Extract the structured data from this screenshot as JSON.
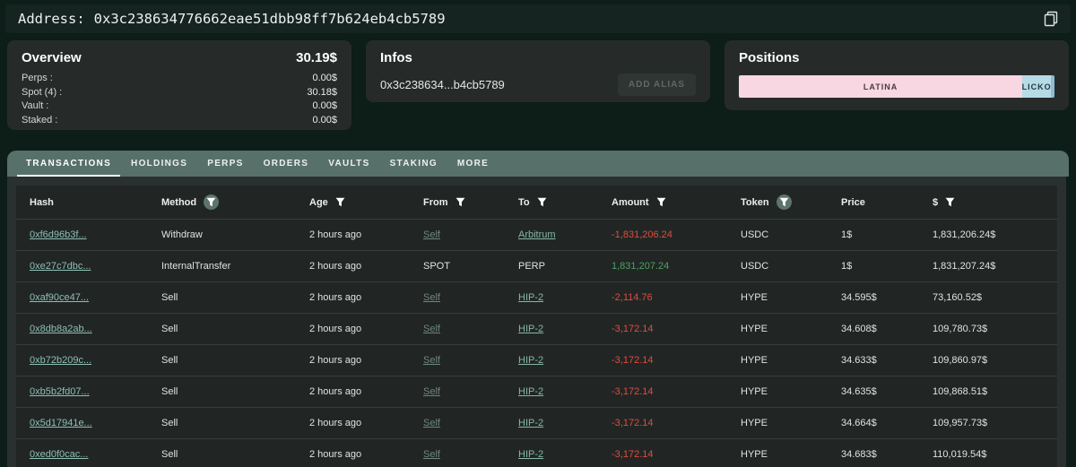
{
  "address_bar": {
    "label": "Address:",
    "value": "0x3c238634776662eae51dbb98ff7b624eb4cb5789",
    "copy_icon": "copy-icon"
  },
  "overview": {
    "title": "Overview",
    "total": "30.19$",
    "rows": [
      {
        "label": "Perps :",
        "value": "0.00$"
      },
      {
        "label": "Spot (4) :",
        "value": "30.18$"
      },
      {
        "label": "Vault :",
        "value": "0.00$"
      },
      {
        "label": "Staked :",
        "value": "0.00$"
      }
    ]
  },
  "infos": {
    "title": "Infos",
    "address_short": "0x3c238634...b4cb5789",
    "add_alias_label": "ADD ALIAS"
  },
  "positions": {
    "title": "Positions",
    "segments": [
      {
        "label": "LATINA",
        "width_pct": 89.8,
        "bg": "#f8d6e2",
        "fg": "#4a3b42"
      },
      {
        "label": "LICKO",
        "width_pct": 9.1,
        "bg": "#b7dae7",
        "fg": "#233941"
      },
      {
        "label": "",
        "width_pct": 1.1,
        "bg": "#8fbcd2",
        "fg": "#233941"
      }
    ]
  },
  "tabs": [
    {
      "label": "TRANSACTIONS",
      "active": true
    },
    {
      "label": "HOLDINGS",
      "active": false
    },
    {
      "label": "PERPS",
      "active": false
    },
    {
      "label": "ORDERS",
      "active": false
    },
    {
      "label": "VAULTS",
      "active": false
    },
    {
      "label": "STAKING",
      "active": false
    },
    {
      "label": "MORE",
      "active": false
    }
  ],
  "table": {
    "columns": [
      {
        "label": "Hash",
        "filter": "none"
      },
      {
        "label": "Method",
        "filter": "active"
      },
      {
        "label": "Age",
        "filter": "plain"
      },
      {
        "label": "From",
        "filter": "plain"
      },
      {
        "label": "To",
        "filter": "plain"
      },
      {
        "label": "Amount",
        "filter": "plain"
      },
      {
        "label": "Token",
        "filter": "active"
      },
      {
        "label": "Price",
        "filter": "none"
      },
      {
        "label": "$",
        "filter": "plain"
      }
    ],
    "rows": [
      {
        "hash": "0xf6d96b3f...",
        "method": "Withdraw",
        "age": "2 hours ago",
        "from": "Self",
        "from_link": true,
        "to": "Arbitrum",
        "to_link": true,
        "amount": "-1,831,206.24",
        "negative": true,
        "token": "USDC",
        "price": "1$",
        "usd": "1,831,206.24$"
      },
      {
        "hash": "0xe27c7dbc...",
        "method": "InternalTransfer",
        "age": "2 hours ago",
        "from": "SPOT",
        "from_link": false,
        "to": "PERP",
        "to_link": false,
        "amount": "1,831,207.24",
        "negative": false,
        "token": "USDC",
        "price": "1$",
        "usd": "1,831,207.24$"
      },
      {
        "hash": "0xaf90ce47...",
        "method": "Sell",
        "age": "2 hours ago",
        "from": "Self",
        "from_link": true,
        "to": "HIP-2",
        "to_link": true,
        "amount": "-2,114.76",
        "negative": true,
        "token": "HYPE",
        "price": "34.595$",
        "usd": "73,160.52$"
      },
      {
        "hash": "0x8db8a2ab...",
        "method": "Sell",
        "age": "2 hours ago",
        "from": "Self",
        "from_link": true,
        "to": "HIP-2",
        "to_link": true,
        "amount": "-3,172.14",
        "negative": true,
        "token": "HYPE",
        "price": "34.608$",
        "usd": "109,780.73$"
      },
      {
        "hash": "0xb72b209c...",
        "method": "Sell",
        "age": "2 hours ago",
        "from": "Self",
        "from_link": true,
        "to": "HIP-2",
        "to_link": true,
        "amount": "-3,172.14",
        "negative": true,
        "token": "HYPE",
        "price": "34.633$",
        "usd": "109,860.97$"
      },
      {
        "hash": "0xb5b2fd07...",
        "method": "Sell",
        "age": "2 hours ago",
        "from": "Self",
        "from_link": true,
        "to": "HIP-2",
        "to_link": true,
        "amount": "-3,172.14",
        "negative": true,
        "token": "HYPE",
        "price": "34.635$",
        "usd": "109,868.51$"
      },
      {
        "hash": "0x5d17941e...",
        "method": "Sell",
        "age": "2 hours ago",
        "from": "Self",
        "from_link": true,
        "to": "HIP-2",
        "to_link": true,
        "amount": "-3,172.14",
        "negative": true,
        "token": "HYPE",
        "price": "34.664$",
        "usd": "109,957.73$"
      },
      {
        "hash": "0xed0f0cac...",
        "method": "Sell",
        "age": "2 hours ago",
        "from": "Self",
        "from_link": true,
        "to": "HIP-2",
        "to_link": true,
        "amount": "-3,172.14",
        "negative": true,
        "token": "HYPE",
        "price": "34.683$",
        "usd": "110,019.54$"
      }
    ]
  },
  "colors": {
    "background": "#0d1d18",
    "topbar": "#152420",
    "card": "#262b2a",
    "tabbar": "#57706a",
    "panel": "#2a2f2f",
    "table": "#212625",
    "negative": "#e04b3d",
    "positive": "#4fa05f",
    "hash_link": "#8fbfb4",
    "position_pink": "#f8d6e2",
    "position_blue": "#b7dae7"
  }
}
